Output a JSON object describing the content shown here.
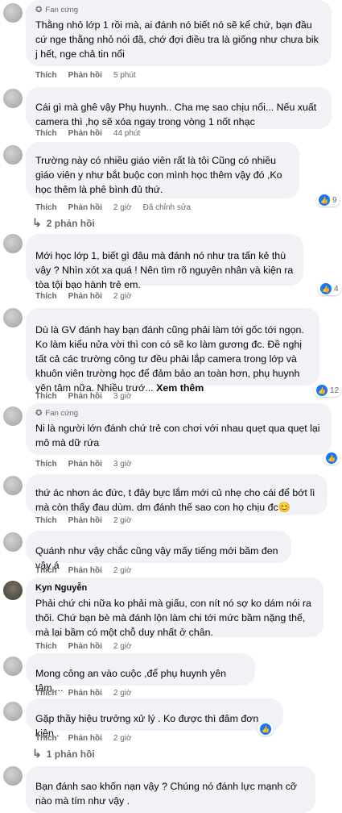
{
  "ui": {
    "like_label": "Thích",
    "reply_label": "Phản hồi",
    "fan_badge": "Fan cứng"
  },
  "comments": [
    {
      "text": "Thằng nhỏ lớp 1 rồi mà, ai đánh nó biết nó sẽ kể chứ, bạn đầu cứ nge thằng nhỏ nói đã, chớ đợi điều tra là giống như chưa bik j hết, nge chả tin nổi",
      "time": "5 phút"
    },
    {
      "text": "Cái gì mà ghê vậy Phụ huynh.. Cha mẹ sao chịu nổi... Nếu xuất camera thì ,họ sẽ xóa ngay trong vòng 1 nốt nhạc",
      "time": "44 phút"
    },
    {
      "text": "Trường này có nhiều giáo viên rất là tôi Cũng có nhiều giáo viên y như bắt buộc con mình học thêm vậy đó ,Ko học thêm là phê bình đủ thứ.",
      "time": "2 giờ",
      "edited": "Đã chỉnh sửa",
      "reactions": "9",
      "replies": "2 phản hồi"
    },
    {
      "text": "Mới học lớp 1, biết gì đâu mà đánh nó như tra tấn kẻ thù vậy ? Nhìn xót xa quá ! Nên tìm rõ nguyên nhân và kiện ra tòa tội bạo hành trẻ em.",
      "time": "2 giờ",
      "reactions": "4"
    },
    {
      "text": "Dù là GV đánh hay bạn đánh cũng phải làm tới gốc tới ngọn. Ko làm kiểu nửa vời thì con có sẽ ko làm gương đc. Đề nghị tất cả các trường công tư đều phải lắp camera trong lớp và khuôn viên trường học để đảm bảo an toàn hơn, phụ huynh yên tâm nữa. Nhiều trướ...",
      "see_more": "Xem thêm",
      "time": "3 giờ",
      "reactions": "12"
    },
    {
      "text": "Ni là người lớn đánh chứ trẻ con chơi với nhau quẹt qua quẹt lại mô mà dữ rứa",
      "time": "3 giờ"
    },
    {
      "text": "thứ ác nhơn ác đức, t đây bực lắm mới củ nhẹ cho cái để bớt lì mà còn thấy đau dùm. dm đánh thế sao con họ chịu đc😊",
      "time": "2 giờ"
    },
    {
      "text": "Quánh như vậy chắc cũng vậy mấy tiếng mới bầm đen vậy á",
      "time": "2 giờ"
    },
    {
      "name": "Kyn Nguyễn",
      "text": "Phải chứ chi nữa ko phải mà giấu, con nít nó sợ ko dám nói ra thôi. Chứ bạn bè mà đánh lộn làm chi tới mức bầm nặng thế, mà lại bầm có một chỗ duy nhất ở chân.",
      "time": "2 giờ"
    },
    {
      "text": "Mong công an vào cuộc ,để phụ huynh yên tâm ...",
      "time": "2 giờ"
    },
    {
      "text": "Gặp thầy hiệu trưởng xử lý . Ko được thì đâm đơn kiện .",
      "time": "2 giờ",
      "replies": "1 phản hồi"
    },
    {
      "text": "Bạn đánh sao khốn nạn vậy ? Chúng nó đánh lực mạnh cỡ nào mà tím như vậy ."
    }
  ]
}
